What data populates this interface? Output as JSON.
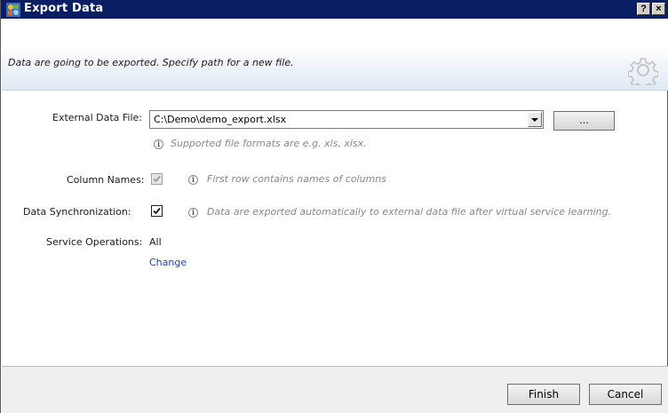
{
  "window": {
    "title": "Export Data",
    "help_label": "?",
    "close_label": "×",
    "icon": "export-data-icon"
  },
  "header": {
    "description": "Data are going to be exported. Specify path for a new file.",
    "icon": "gear-icon"
  },
  "external_file": {
    "label": "External Data File:",
    "value": "C:\\Demo\\demo_export.xlsx",
    "browse_label": "...",
    "hint": "Supported file formats are e.g. xls, xlsx."
  },
  "column_names": {
    "label": "Column Names:",
    "checked": true,
    "enabled": false,
    "hint": "First row contains names of columns"
  },
  "data_sync": {
    "label": "Data Synchronization:",
    "checked": true,
    "enabled": true,
    "hint": "Data are exported automatically to external data file after virtual service learning."
  },
  "service_operations": {
    "label": "Service Operations:",
    "value": "All",
    "change_label": "Change"
  },
  "footer": {
    "finish_label": "Finish",
    "cancel_label": "Cancel"
  },
  "colors": {
    "titlebar": "#0a1f63",
    "link": "#1f3fbf",
    "hint": "#888888"
  }
}
